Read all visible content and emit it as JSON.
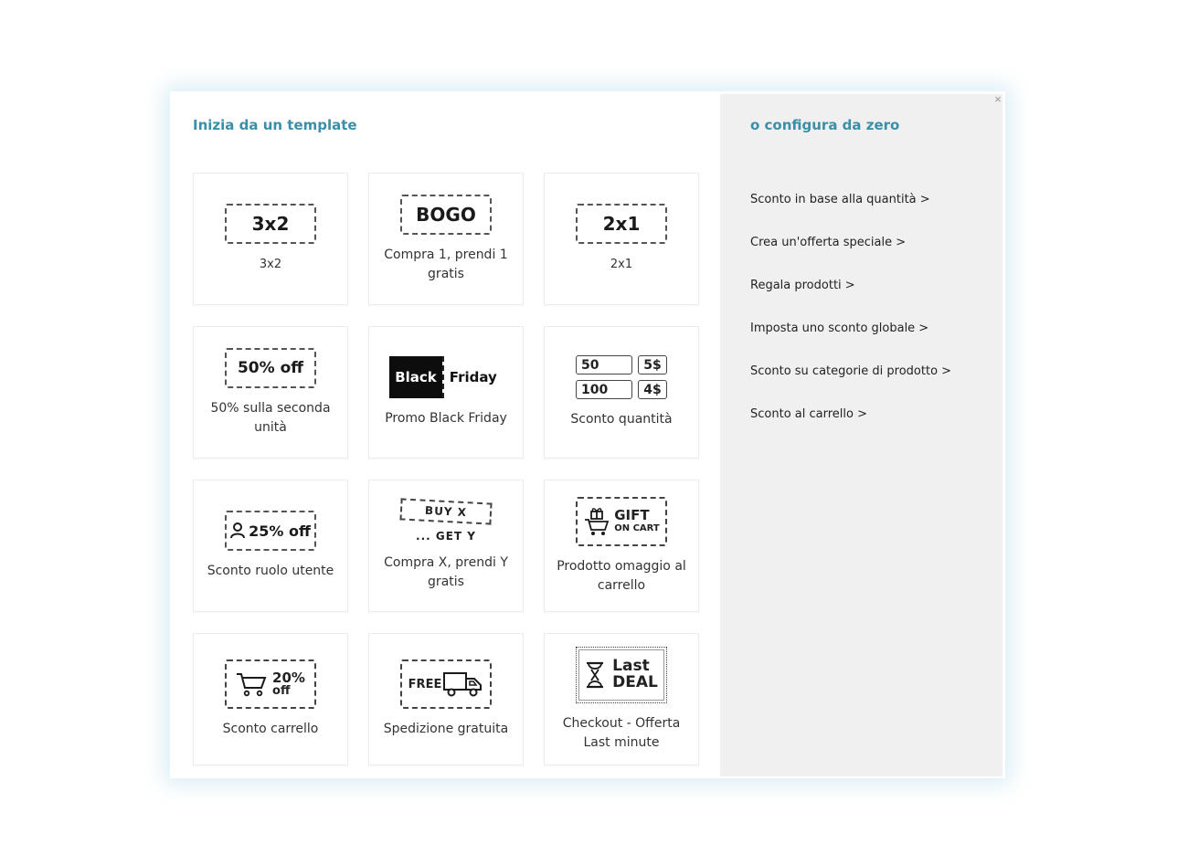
{
  "left": {
    "title": "Inizia da un template",
    "templates": [
      {
        "icon": "3x2",
        "label": "3x2"
      },
      {
        "icon": "BOGO",
        "label": "Compra 1, prendi 1 gratis"
      },
      {
        "icon": "2x1",
        "label": "2x1"
      },
      {
        "icon": "50% off",
        "label": "50% sulla seconda unità"
      },
      {
        "icon_black": "Black",
        "icon_white": "Friday",
        "label": "Promo Black Friday"
      },
      {
        "q1": "50",
        "p1": "5$",
        "q2": "100",
        "p2": "4$",
        "label": "Sconto quantità"
      },
      {
        "icon": "25% off",
        "label": "Sconto ruolo utente"
      },
      {
        "icon_top": "BUY X",
        "icon_bottom": "... GET Y",
        "label": "Compra X, prendi Y gratis"
      },
      {
        "icon_top": "GIFT",
        "icon_bottom": "ON CART",
        "label": "Prodotto omaggio al carrello"
      },
      {
        "icon_top": "20%",
        "icon_bottom": "off",
        "label": "Sconto carrello"
      },
      {
        "icon": "FREE",
        "label": "Spedizione gratuita"
      },
      {
        "icon_top": "Last",
        "icon_bottom": "DEAL",
        "label": "Checkout - Offerta Last minute"
      }
    ]
  },
  "right": {
    "title": "o configura da zero",
    "close": "×",
    "options": [
      "Sconto in base alla quantità >",
      "Crea un'offerta speciale >",
      "Regala prodotti >",
      "Imposta uno sconto globale >",
      "Sconto su categorie di prodotto >",
      "Sconto al carrello >"
    ]
  }
}
